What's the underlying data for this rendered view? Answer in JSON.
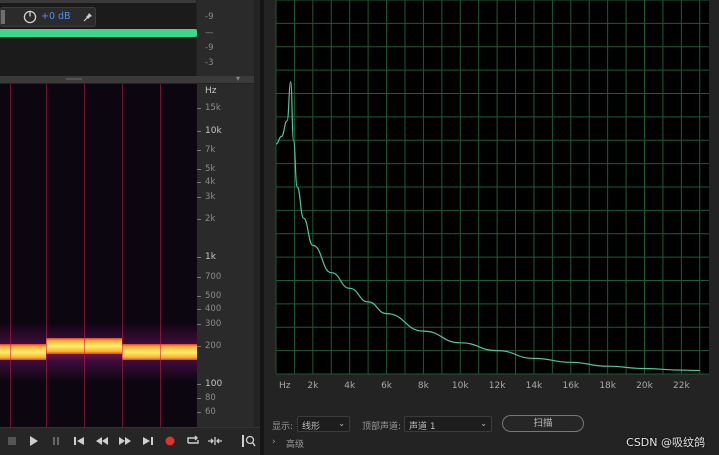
{
  "volume_hud": {
    "gain": "+0 dB",
    "knob_icon": "gain-knob",
    "pin_icon": "pin"
  },
  "level_meter_scale": [
    "-9",
    "—",
    "-9",
    "-3"
  ],
  "frequency_ruler": {
    "unit": "Hz",
    "ticks": [
      {
        "label": "15k",
        "major": false
      },
      {
        "label": "10k",
        "major": true
      },
      {
        "label": "7k",
        "major": false
      },
      {
        "label": "5k",
        "major": false
      },
      {
        "label": "4k",
        "major": false
      },
      {
        "label": "3k",
        "major": false
      },
      {
        "label": "2k",
        "major": false
      },
      {
        "label": "1k",
        "major": true
      },
      {
        "label": "700",
        "major": false
      },
      {
        "label": "500",
        "major": false
      },
      {
        "label": "400",
        "major": false
      },
      {
        "label": "300",
        "major": false
      },
      {
        "label": "200",
        "major": false
      },
      {
        "label": "100",
        "major": true
      },
      {
        "label": "80",
        "major": false
      },
      {
        "label": "60",
        "major": false
      }
    ]
  },
  "transport": {
    "buttons": [
      "stop",
      "play",
      "pause",
      "go-to-previous",
      "rewind",
      "fast-forward",
      "go-to-next",
      "record",
      "loop",
      "skip-selection",
      "zoom-to-fit"
    ],
    "record_color": "#e0322b"
  },
  "colors": {
    "waveform_clip": "#3fd58d",
    "gain_text": "#4d8ff0",
    "analysis_curve": "#4fc79a",
    "analysis_grid": "#1f5a37"
  },
  "analysis": {
    "x_labels": [
      "Hz",
      "2k",
      "4k",
      "6k",
      "8k",
      "10k",
      "12k",
      "14k",
      "16k",
      "18k",
      "20k",
      "22k"
    ],
    "display_label": "显示:",
    "display_value": "线形",
    "channel_label": "顶部声道:",
    "channel_value": "声道 1",
    "scan_button": "扫描",
    "advanced_label": "高级"
  },
  "chart_data": {
    "type": "line",
    "xlabel": "",
    "ylabel": "",
    "xlim": [
      0,
      23500
    ],
    "ylim": [
      -93,
      3
    ],
    "grid": true,
    "x_ticks": [
      "Hz",
      "2k",
      "4k",
      "6k",
      "8k",
      "10k",
      "12k",
      "14k",
      "16k",
      "18k",
      "20k",
      "22k"
    ],
    "series": [
      {
        "x": [
          0,
          300,
          600,
          800,
          950,
          1150,
          1500,
          2000,
          3000,
          4000,
          5000,
          6000,
          8000,
          10000,
          12000,
          14000,
          16000,
          18000,
          20000,
          22000,
          23000
        ],
        "y": [
          -34,
          -32,
          -28,
          -18,
          -33,
          -45,
          -53,
          -60,
          -67,
          -71,
          -74.5,
          -77.5,
          -82,
          -85,
          -87,
          -89,
          -90,
          -91,
          -91.6,
          -92,
          -92.1
        ]
      }
    ]
  },
  "watermark": "CSDN @吸纹鸽"
}
